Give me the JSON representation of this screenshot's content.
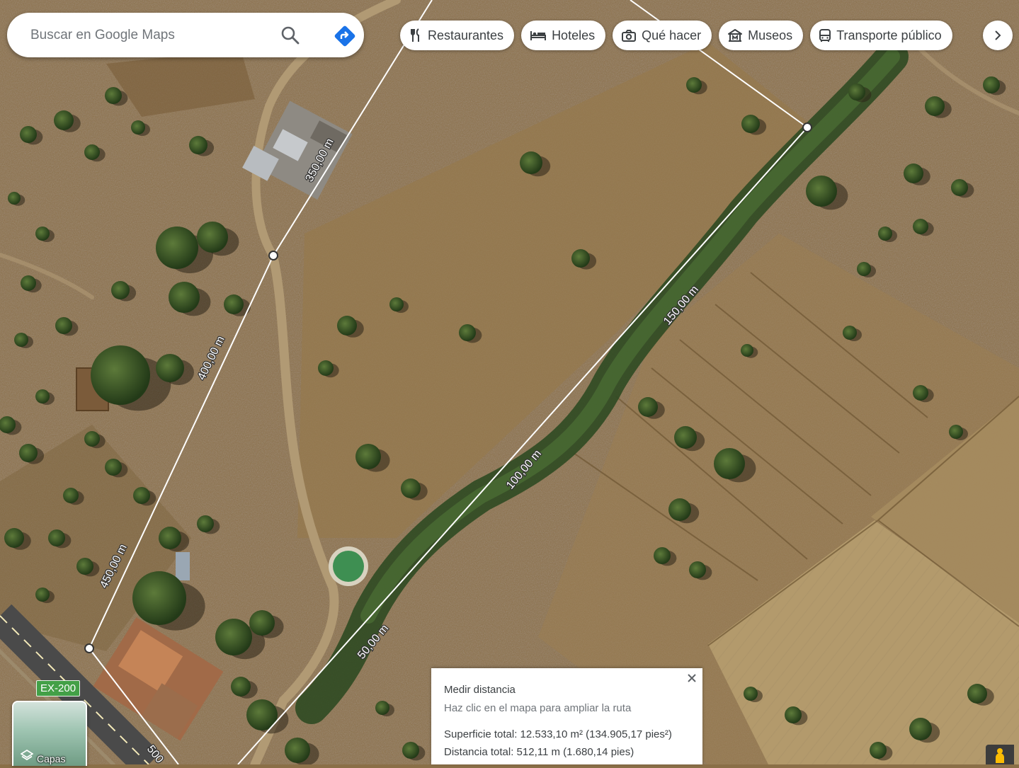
{
  "search": {
    "placeholder": "Buscar en Google Maps",
    "value": ""
  },
  "chips": [
    {
      "label": "Restaurantes",
      "icon": "fork-knife-icon"
    },
    {
      "label": "Hoteles",
      "icon": "bed-icon"
    },
    {
      "label": "Qué hacer",
      "icon": "camera-icon"
    },
    {
      "label": "Museos",
      "icon": "museum-icon"
    },
    {
      "label": "Transporte público",
      "icon": "bus-icon"
    }
  ],
  "measure_panel": {
    "title": "Medir distancia",
    "hint": "Haz clic en el mapa para ampliar la ruta",
    "area": "Superficie total: 12.533,10 m² (134.905,17 pies²)",
    "distance": "Distancia total: 512,11 m (1.680,14 pies)"
  },
  "measure_labels": [
    "350,00 m",
    "400,00 m",
    "450,00 m",
    "500",
    "150,00 m",
    "100,00 m",
    "50,00 m"
  ],
  "road_badge": "EX-200",
  "layers": {
    "label": "Capas"
  },
  "colors": {
    "accent": "#1a73e8",
    "measure_line": "#ffffff",
    "road_badge": "#43a047"
  }
}
